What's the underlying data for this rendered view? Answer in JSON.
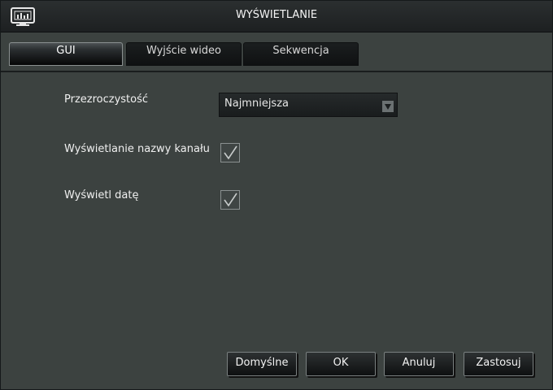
{
  "window": {
    "title": "WYŚWIETLANIE",
    "icon": "monitor-chart-icon"
  },
  "tabs": [
    {
      "label": "GUI",
      "active": true
    },
    {
      "label": "Wyjście wideo",
      "active": false
    },
    {
      "label": "Sekwencja",
      "active": false
    }
  ],
  "settings": {
    "transparency": {
      "label": "Przezroczystość",
      "value": "Najmniejsza",
      "icon": "dropdown-arrow-icon"
    },
    "channel_name": {
      "label": "Wyświetlanie nazwy kanału",
      "checked": true
    },
    "show_date": {
      "label": "Wyświetl datę",
      "checked": true
    }
  },
  "buttons": {
    "defaults": "Domyślne",
    "ok": "OK",
    "cancel": "Anuluj",
    "apply": "Zastosuj"
  },
  "colors": {
    "background": "#3c4240",
    "titlebar": "#1d2021",
    "text": "#f2f2f2"
  }
}
